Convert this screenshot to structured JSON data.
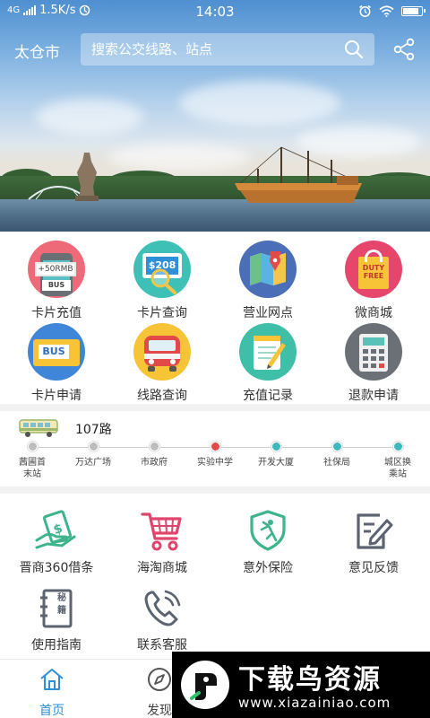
{
  "status_bar": {
    "network": "4G",
    "speed": "1.5K/s",
    "time": "14:03"
  },
  "header": {
    "city": "太仓市",
    "search_placeholder": "搜索公交线路、站点"
  },
  "quick_actions": [
    {
      "label": "卡片充值",
      "icon": "card-recharge-icon"
    },
    {
      "label": "卡片查询",
      "icon": "card-query-icon"
    },
    {
      "label": "营业网点",
      "icon": "map-outlet-icon"
    },
    {
      "label": "微商城",
      "icon": "shopping-bag-icon"
    },
    {
      "label": "卡片申请",
      "icon": "bus-card-icon"
    },
    {
      "label": "线路查询",
      "icon": "bus-front-icon"
    },
    {
      "label": "充值记录",
      "icon": "notepad-icon"
    },
    {
      "label": "退款申请",
      "icon": "calculator-icon"
    }
  ],
  "card_texts": {
    "recharge_amount": "+50RMB",
    "bus": "BUS",
    "query_amount": "$208",
    "duty_free": "DUTY FREE"
  },
  "route": {
    "name": "107路",
    "stops": [
      {
        "name": "茜圃首末站",
        "line1": "茜圃首",
        "line2": "末站",
        "state": "passed"
      },
      {
        "name": "万达广场",
        "line1": "万达广场",
        "line2": "",
        "state": "passed"
      },
      {
        "name": "市政府",
        "line1": "市政府",
        "line2": "",
        "state": "passed"
      },
      {
        "name": "实验中学",
        "line1": "实验中学",
        "line2": "",
        "state": "current"
      },
      {
        "name": "开发大厦",
        "line1": "开发大厦",
        "line2": "",
        "state": "upcoming"
      },
      {
        "name": "社保局",
        "line1": "社保局",
        "line2": "",
        "state": "upcoming"
      },
      {
        "name": "城区换乘站",
        "line1": "城区换",
        "line2": "乘站",
        "state": "upcoming"
      }
    ]
  },
  "services": [
    {
      "label": "晋商360借条",
      "icon": "money-hand-icon"
    },
    {
      "label": "海淘商城",
      "icon": "shopping-cart-icon"
    },
    {
      "label": "意外保险",
      "icon": "shield-icon"
    },
    {
      "label": "意见反馈",
      "icon": "feedback-edit-icon"
    },
    {
      "label": "使用指南",
      "icon": "guide-book-icon"
    },
    {
      "label": "联系客服",
      "icon": "phone-icon"
    }
  ],
  "guide_book_text": "秘籍",
  "bottom_nav": [
    {
      "label": "首页",
      "icon": "home-icon",
      "active": true
    },
    {
      "label": "发现",
      "icon": "compass-icon",
      "active": false
    }
  ],
  "watermark": {
    "text": "下载鸟资源",
    "url": "www.xiazainiao.com"
  },
  "colors": {
    "accent": "#2f8fd8",
    "passed_stop": "#bdbdbd",
    "current_stop": "#e24a4a",
    "upcoming_stop": "#3fb8bd",
    "service_green": "#3db48c",
    "service_pink": "#e0456b",
    "service_gray": "#5b6470"
  }
}
